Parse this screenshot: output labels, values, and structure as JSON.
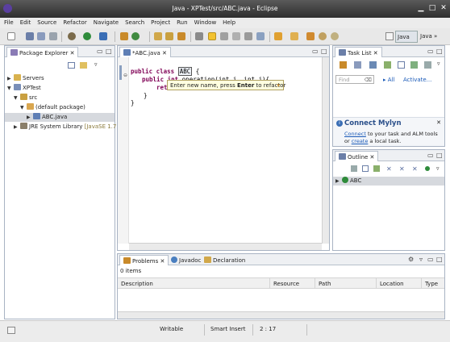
{
  "window": {
    "title": "Java - XPTest/src/ABC.java - Eclipse"
  },
  "menu": [
    "File",
    "Edit",
    "Source",
    "Refactor",
    "Navigate",
    "Search",
    "Project",
    "Run",
    "Window",
    "Help"
  ],
  "perspective": {
    "java_label": "Java",
    "debug_label": "Java"
  },
  "package_explorer": {
    "tab": "Package Explorer",
    "tree": {
      "servers": "Servers",
      "project": "XPTest",
      "src": "src",
      "default_package": "(default package)",
      "file": "ABC.java",
      "jre": "JRE System Library",
      "jre_version": "[JavaSE 1.7]"
    }
  },
  "editor": {
    "tab": "*ABC.java",
    "code": {
      "kw_public1": "public",
      "kw_class": "class",
      "class_name": "ABC",
      "brace_open": " {",
      "kw_public2": "public",
      "kw_int": "int",
      "method_sig": "operation(int i, int j){",
      "kw_return": "retu",
      "close_inner": "}",
      "close_outer": "}"
    },
    "rename_hint": {
      "before": "Enter new name, press ",
      "bold": "Enter",
      "after": " to refactor"
    }
  },
  "task_list": {
    "tab": "Task List",
    "find_placeholder": "Find",
    "all_label": "All",
    "activate_label": "Activate...",
    "mylyn_title": "Connect Mylyn",
    "mylyn_link1": "Connect",
    "mylyn_text1": " to your task and ALM tools or ",
    "mylyn_link2": "create",
    "mylyn_text2": " a local task."
  },
  "outline": {
    "tab": "Outline",
    "item": "ABC"
  },
  "bottom": {
    "tabs": [
      "Problems",
      "Javadoc",
      "Declaration"
    ],
    "count": "0 items",
    "columns": [
      "Description",
      "Resource",
      "Path",
      "Location",
      "Type"
    ]
  },
  "status": {
    "writable": "Writable",
    "insert_mode": "Smart Insert",
    "position": "2 : 17"
  },
  "colors": {
    "keyword": "#7f0055",
    "hint_bg": "#ffffe0",
    "selection": "#d6d9de",
    "link": "#1a5ab8"
  }
}
